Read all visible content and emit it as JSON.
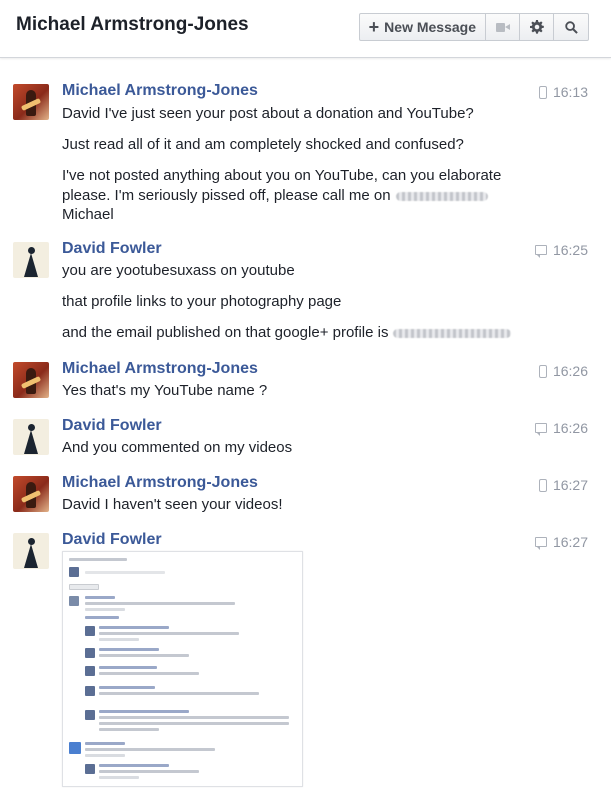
{
  "header": {
    "title": "Michael Armstrong-Jones",
    "new_message_label": "New Message",
    "icons": [
      "plus-icon",
      "video-camera-icon",
      "gear-icon",
      "search-icon"
    ]
  },
  "messages": [
    {
      "sender": "Michael Armstrong-Jones",
      "time": "16:13",
      "source_icon": "mobile-icon",
      "lines": [
        "David I've just seen your post about a donation and YouTube?",
        "Just read all of it and am completely shocked and confused?",
        "I've not posted anything about you on YouTube, can you elaborate",
        "please. I'm seriously pissed off, please call me on",
        "Michael"
      ]
    },
    {
      "sender": "David Fowler",
      "time": "16:25",
      "source_icon": "chat-icon",
      "lines": [
        "you are yootubesuxass on youtube",
        "that profile links to your photography page",
        "and the email published on that google+ profile is"
      ]
    },
    {
      "sender": "Michael Armstrong-Jones",
      "time": "16:26",
      "source_icon": "mobile-icon",
      "lines": [
        "Yes that's my YouTube name ?"
      ]
    },
    {
      "sender": "David Fowler",
      "time": "16:26",
      "source_icon": "chat-icon",
      "lines": [
        "And you commented on my videos"
      ]
    },
    {
      "sender": "Michael Armstrong-Jones",
      "time": "16:27",
      "source_icon": "mobile-icon",
      "lines": [
        "David I haven't seen your videos!"
      ]
    },
    {
      "sender": "David Fowler",
      "time": "16:27",
      "source_icon": "chat-icon",
      "lines": []
    }
  ],
  "colors": {
    "sender_link": "#3b5998",
    "timestamp": "#9197a3",
    "body_text": "#1d2129"
  }
}
